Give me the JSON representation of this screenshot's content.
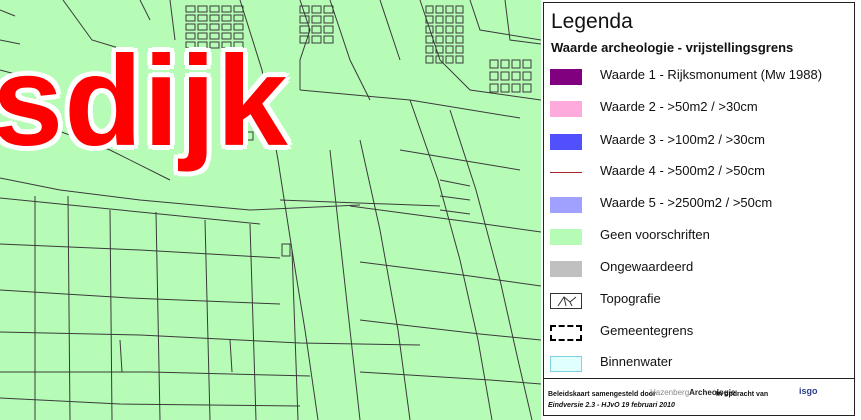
{
  "map": {
    "place_name": "sdijk",
    "land_color": "#b6fcb6",
    "parcel_line_color": "#3a3a3a",
    "label_color": "#ff0000"
  },
  "legend": {
    "title": "Legenda",
    "subtitle": "Waarde archeologie - vrijstellingsgrens",
    "items": [
      {
        "label": "Waarde 1 - Rijksmonument (Mw 1988)",
        "symbol": "fill",
        "color": "#800080"
      },
      {
        "label": "Waarde 2 - >50m2 / >30cm",
        "symbol": "fill",
        "color": "#ffaadd"
      },
      {
        "label": "Waarde 3 - >100m2 / >30cm",
        "symbol": "fill",
        "color": "#5050ff"
      },
      {
        "label": "Waarde 4 - >500m2 / >50cm",
        "symbol": "line",
        "color": "#a52a2a"
      },
      {
        "label": "Waarde 5 - >2500m2 / >50cm",
        "symbol": "fill",
        "color": "#a0a0ff"
      },
      {
        "label": "Geen voorschriften",
        "symbol": "fill",
        "color": "#b6fcb6"
      },
      {
        "label": "Ongewaardeerd",
        "symbol": "fill",
        "color": "#c0c0c0"
      },
      {
        "label": "Topografie",
        "symbol": "topography-icon",
        "color": "#ffffff"
      },
      {
        "label": "Gemeentegrens",
        "symbol": "dashed",
        "color": "#000000"
      },
      {
        "label": "Binnenwater",
        "symbol": "water",
        "color": "#e0ffff"
      }
    ],
    "footer": {
      "line1": "Beleidskaart samengesteld door",
      "company_prefix": "Hazenberg",
      "company_name": "Archeologie",
      "commission": "In opdracht van",
      "client": "isgo",
      "version": "Eindversie 2.3 - HJvO 19 februari 2010"
    }
  }
}
